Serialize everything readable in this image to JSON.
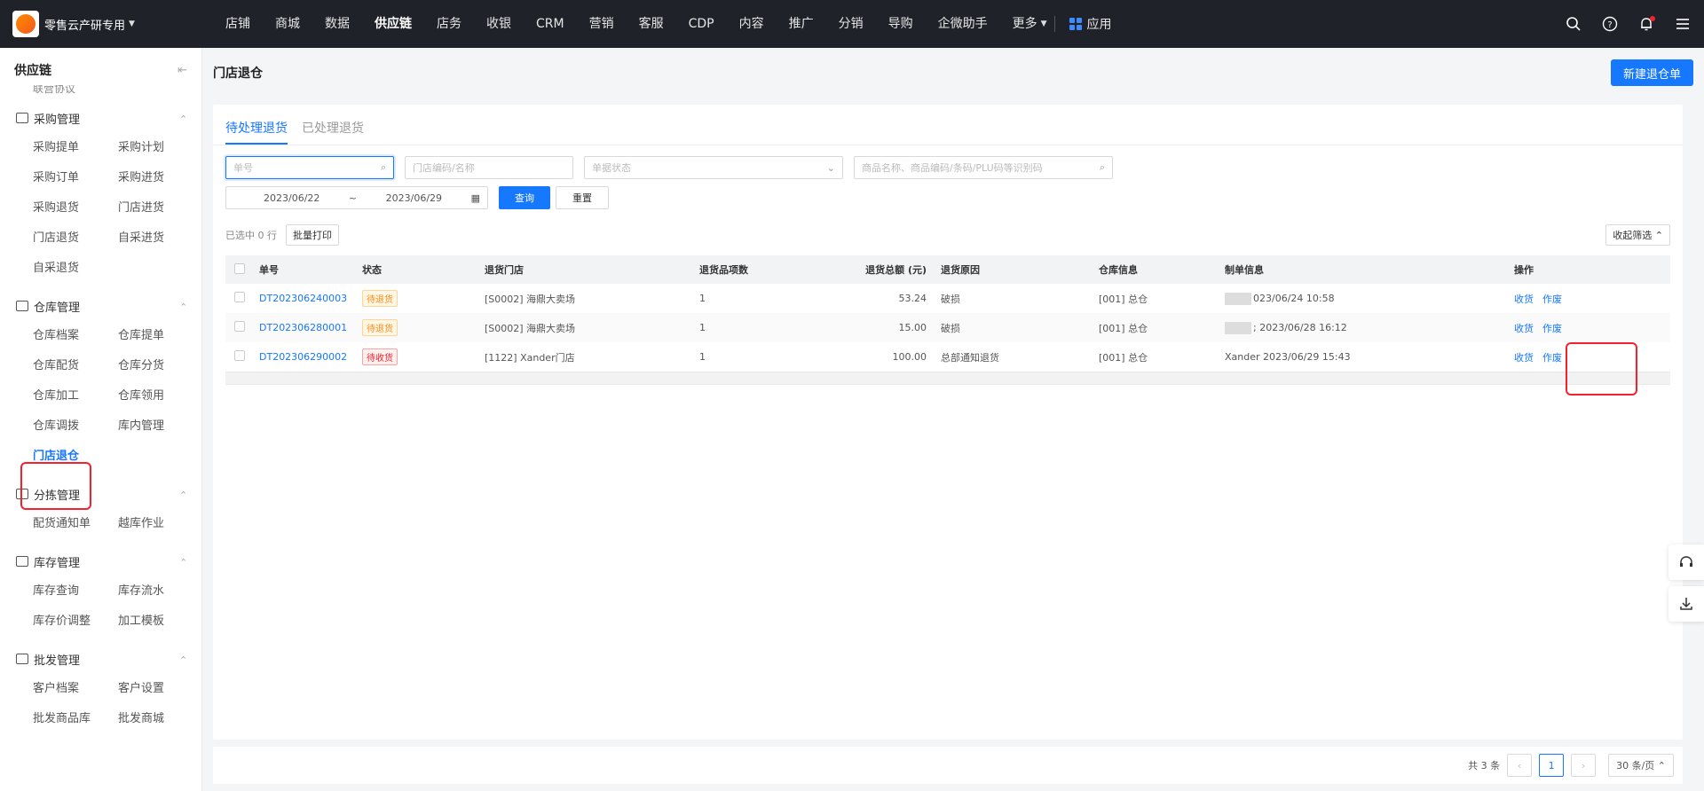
{
  "brand": {
    "name": "零售云产研专用"
  },
  "nav": [
    "店铺",
    "商城",
    "数据",
    "供应链",
    "店务",
    "收银",
    "CRM",
    "营销",
    "客服",
    "CDP",
    "内容",
    "推广",
    "分销",
    "导购",
    "企微助手",
    "更多"
  ],
  "nav_active": "供应链",
  "apps_label": "应用",
  "sidebar": {
    "title": "供应链",
    "cut_item": "联营协议",
    "groups": [
      {
        "title": "采购管理",
        "items": [
          "采购提单",
          "采购计划",
          "采购订单",
          "采购进货",
          "采购退货",
          "门店进货",
          "门店退货",
          "自采进货",
          "自采退货"
        ]
      },
      {
        "title": "仓库管理",
        "items": [
          "仓库档案",
          "仓库提单",
          "仓库配货",
          "仓库分货",
          "仓库加工",
          "仓库领用",
          "仓库调拨",
          "库内管理",
          "门店退仓"
        ]
      },
      {
        "title": "分拣管理",
        "items": [
          "配货通知单",
          "越库作业"
        ]
      },
      {
        "title": "库存管理",
        "items": [
          "库存查询",
          "库存流水",
          "库存价调整",
          "加工模板"
        ]
      },
      {
        "title": "批发管理",
        "items": [
          "客户档案",
          "客户设置",
          "批发商品库",
          "批发商城"
        ]
      }
    ],
    "active_item": "门店退仓"
  },
  "page": {
    "title": "门店退仓",
    "new_button": "新建退仓单"
  },
  "tabs": [
    "待处理退货",
    "已处理退货"
  ],
  "filters": {
    "order_no_placeholder": "单号",
    "store_placeholder": "门店编码/名称",
    "status_placeholder": "单据状态",
    "goods_placeholder": "商品名称、商品编码/条码/PLU码等识别码",
    "date_from": "2023/06/22",
    "date_sep": "~",
    "date_to": "2023/06/29",
    "query_button": "查询",
    "reset_button": "重置"
  },
  "toolbar": {
    "selected_text": "已选中 0 行",
    "batch_print": "批量打印",
    "collapse_filter": "收起筛选"
  },
  "table": {
    "headers": [
      "单号",
      "状态",
      "退货门店",
      "退货品项数",
      "退货总额 (元)",
      "退货原因",
      "仓库信息",
      "制单信息",
      "操作"
    ],
    "rows": [
      {
        "no": "DT202306240003",
        "status": "待退货",
        "status_color": "orange",
        "store": "[S0002] 海鼎大卖场",
        "items": "1",
        "amount": "53.24",
        "reason": "破损",
        "warehouse": "[001] 总仓",
        "maker": "023/06/24 10:58",
        "ops": [
          "收货",
          "作废"
        ]
      },
      {
        "no": "DT202306280001",
        "status": "待退货",
        "status_color": "orange",
        "store": "[S0002] 海鼎大卖场",
        "items": "1",
        "amount": "15.00",
        "reason": "破损",
        "warehouse": "[001] 总仓",
        "maker": "; 2023/06/28 16:12",
        "ops": [
          "收货",
          "作废"
        ]
      },
      {
        "no": "DT202306290002",
        "status": "待收货",
        "status_color": "red",
        "store": "[1122] Xander门店",
        "items": "1",
        "amount": "100.00",
        "reason": "总部通知退货",
        "warehouse": "[001] 总仓",
        "maker": "Xander 2023/06/29 15:43",
        "ops": [
          "收货",
          "作废"
        ]
      }
    ]
  },
  "pager": {
    "total": "共 3 条",
    "page": "1",
    "size": "30 条/页"
  },
  "colors": {
    "accent": "#1677ff",
    "highlight": "#f5222d",
    "topbar": "#1f2229"
  }
}
